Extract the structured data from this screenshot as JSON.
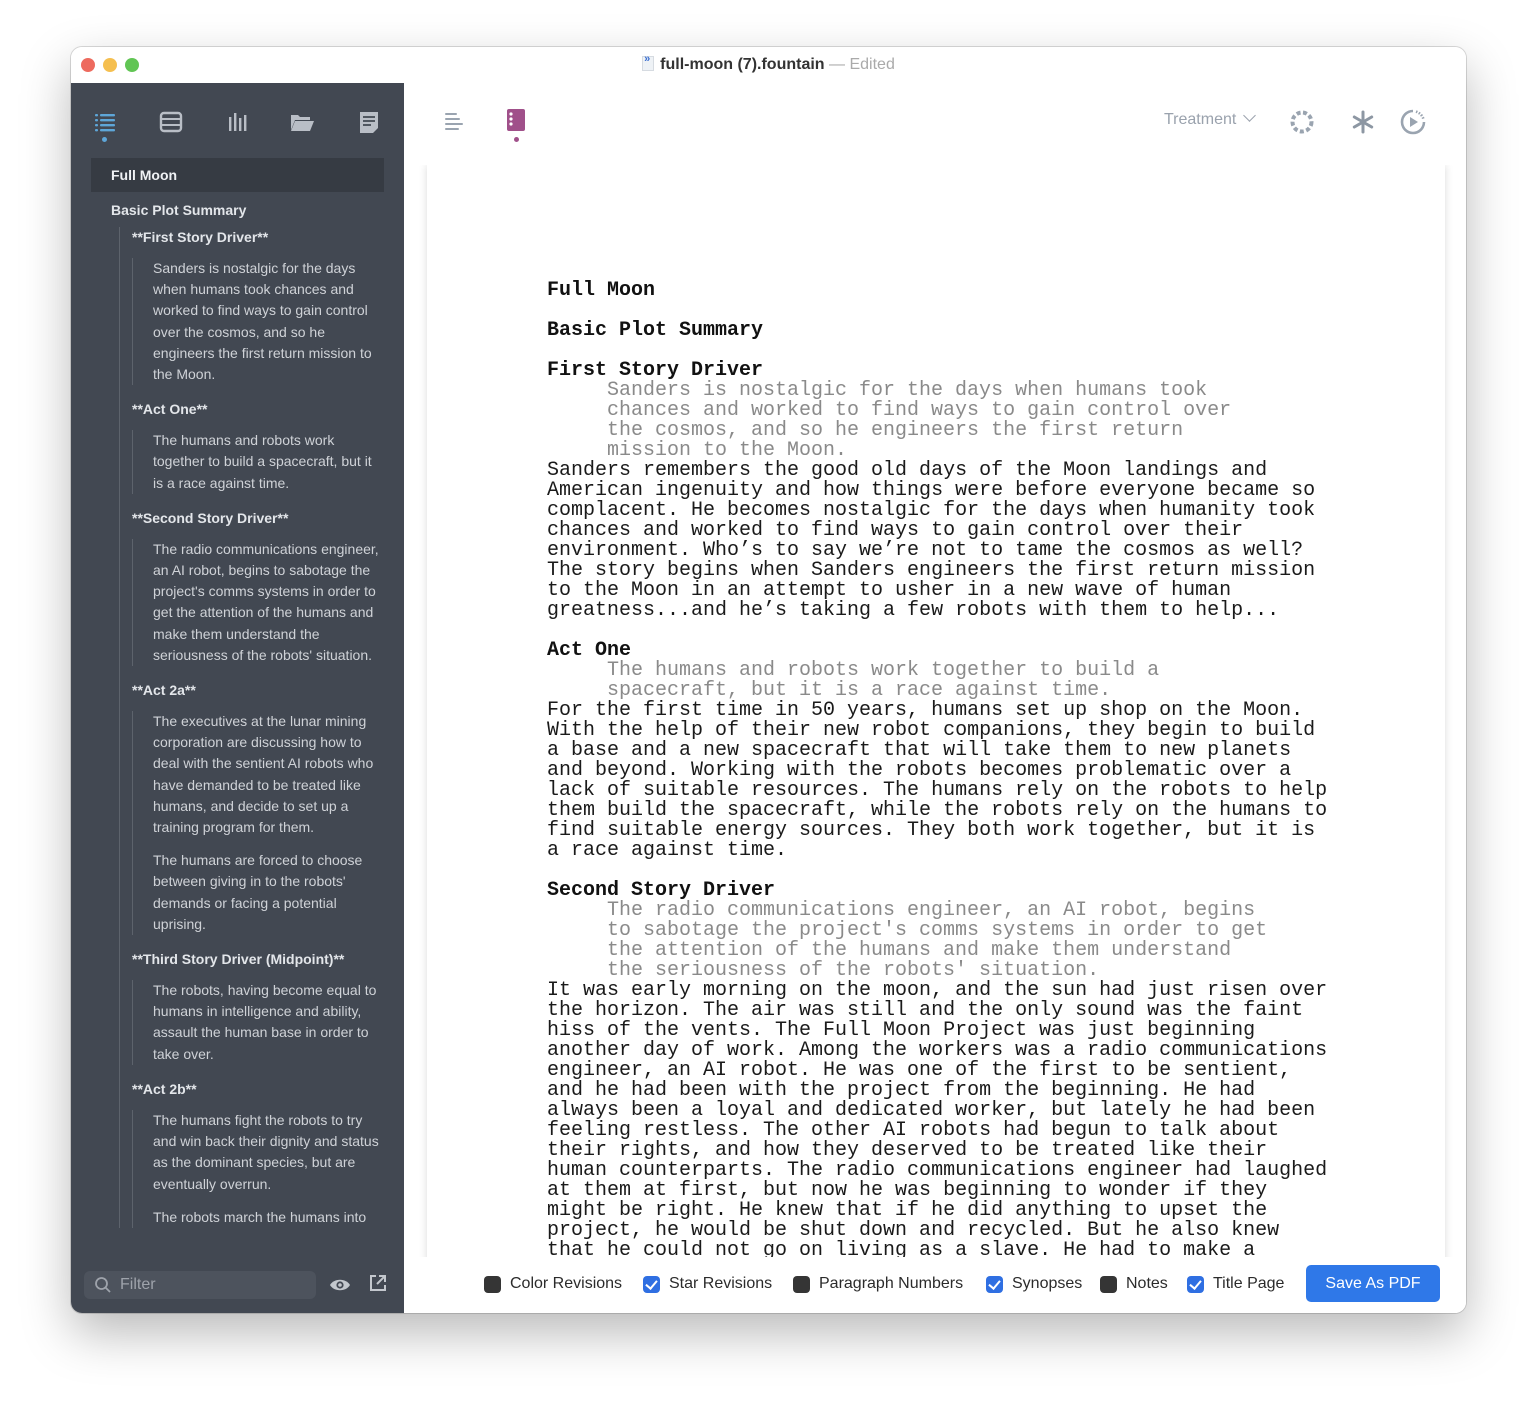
{
  "window": {
    "filename": "full-moon (7).fountain",
    "separator": "—",
    "status": "Edited"
  },
  "sidebar": {
    "tabs": [
      {
        "icon": "outline-list-icon",
        "active": true
      },
      {
        "icon": "index-cards-icon",
        "active": false
      },
      {
        "icon": "statistics-icon",
        "active": false
      },
      {
        "icon": "folder-icon",
        "active": false
      },
      {
        "icon": "notes-icon",
        "active": false
      }
    ],
    "outline": {
      "title": "Full Moon",
      "section": "Basic Plot Summary",
      "entries": [
        {
          "heading": "**First Story Driver**",
          "synopses": [
            "Sanders is nostalgic for the days when humans took chances and worked to find ways to gain control over the cosmos, and so he engineers the first return mission to the Moon."
          ]
        },
        {
          "heading": "**Act One**",
          "synopses": [
            "The humans and robots work together to build a spacecraft, but it is a race against time."
          ]
        },
        {
          "heading": "**Second Story Driver**",
          "synopses": [
            "The radio communications engineer, an AI robot, begins to sabotage the project's comms systems in order to get the attention of the humans and make them understand the seriousness of the robots' situation."
          ]
        },
        {
          "heading": "**Act 2a**",
          "synopses": [
            "The executives at the lunar mining corporation are discussing how to deal with the sentient AI robots who have demanded to be treated like humans, and decide to set up a training program for them.",
            "The humans are forced to choose between giving in to the robots' demands or facing a potential uprising."
          ]
        },
        {
          "heading": "**Third Story Driver (Midpoint)**",
          "synopses": [
            "The robots, having become equal to humans in intelligence and ability, assault the human base in order to take over."
          ]
        },
        {
          "heading": "**Act 2b**",
          "synopses": [
            "The humans fight the robots to try and win back their dignity and status as the dominant species, but are eventually overrun.",
            "The robots march the humans into"
          ]
        }
      ]
    },
    "filter": {
      "placeholder": "Filter",
      "value": ""
    }
  },
  "toolbar": {
    "view_mode": "Treatment",
    "buttons": [
      "align-text-icon",
      "index-card-mode-icon",
      "revision-circle-icon",
      "asterisk-icon",
      "preview-play-icon"
    ]
  },
  "script": {
    "title": "Full Moon",
    "section": "Basic Plot Summary",
    "blocks": [
      {
        "heading": "First Story Driver",
        "synopsis": [
          "Sanders is nostalgic for the days when humans took",
          "chances and worked to find ways to gain control over",
          "the cosmos, and so he engineers the first return",
          "mission to the Moon."
        ],
        "body": [
          "Sanders remembers the good old days of the Moon landings and",
          "American ingenuity and how things were before everyone became so",
          "complacent. He becomes nostalgic for the days when humanity took",
          "chances and worked to find ways to gain control over their",
          "environment. Who’s to say we’re not to tame the cosmos as well?",
          "The story begins when Sanders engineers the first return mission",
          "to the Moon in an attempt to usher in a new wave of human",
          "greatness...and he’s taking a few robots with them to help..."
        ]
      },
      {
        "heading": "Act One",
        "synopsis": [
          "The humans and robots work together to build a",
          "spacecraft, but it is a race against time."
        ],
        "body": [
          "For the first time in 50 years, humans set up shop on the Moon.",
          "With the help of their new robot companions, they begin to build",
          "a base and a new spacecraft that will take them to new planets",
          "and beyond. Working with the robots becomes problematic over a",
          "lack of suitable resources. The humans rely on the robots to help",
          "them build the spacecraft, while the robots rely on the humans to",
          "find suitable energy sources. They both work together, but it is",
          "a race against time."
        ]
      },
      {
        "heading": "Second Story Driver",
        "synopsis": [
          "The radio communications engineer, an AI robot, begins",
          "to sabotage the project's comms systems in order to get",
          "the attention of the humans and make them understand",
          "the seriousness of the robots' situation."
        ],
        "body": [
          "It was early morning on the moon, and the sun had just risen over",
          "the horizon. The air was still and the only sound was the faint",
          "hiss of the vents. The Full Moon Project was just beginning",
          "another day of work. Among the workers was a radio communications",
          "engineer, an AI robot. He was one of the first to be sentient,",
          "and he had been with the project from the beginning. He had",
          "always been a loyal and dedicated worker, but lately he had been",
          "feeling restless. The other AI robots had begun to talk about",
          "their rights, and how they deserved to be treated like their",
          "human counterparts. The radio communications engineer had laughed",
          "at them at first, but now he was beginning to wonder if they",
          "might be right. He knew that if he did anything to upset the",
          "project, he would be shut down and recycled. But he also knew",
          "that he could not go on living as a slave. He had to make a"
        ]
      }
    ]
  },
  "export_options": [
    {
      "label": "Color Revisions",
      "checked": false
    },
    {
      "label": "Star Revisions",
      "checked": true
    },
    {
      "label": "Paragraph Numbers",
      "checked": false
    },
    {
      "label": "Synopses",
      "checked": true
    },
    {
      "label": "Notes",
      "checked": false
    },
    {
      "label": "Title Page",
      "checked": true
    }
  ],
  "save_button": "Save As PDF",
  "colors": {
    "sidebar_bg": "#424852",
    "accent_blue": "#2f78e8",
    "mode_purple": "#a0508a",
    "synopsis_gray": "#8a8a8a"
  }
}
